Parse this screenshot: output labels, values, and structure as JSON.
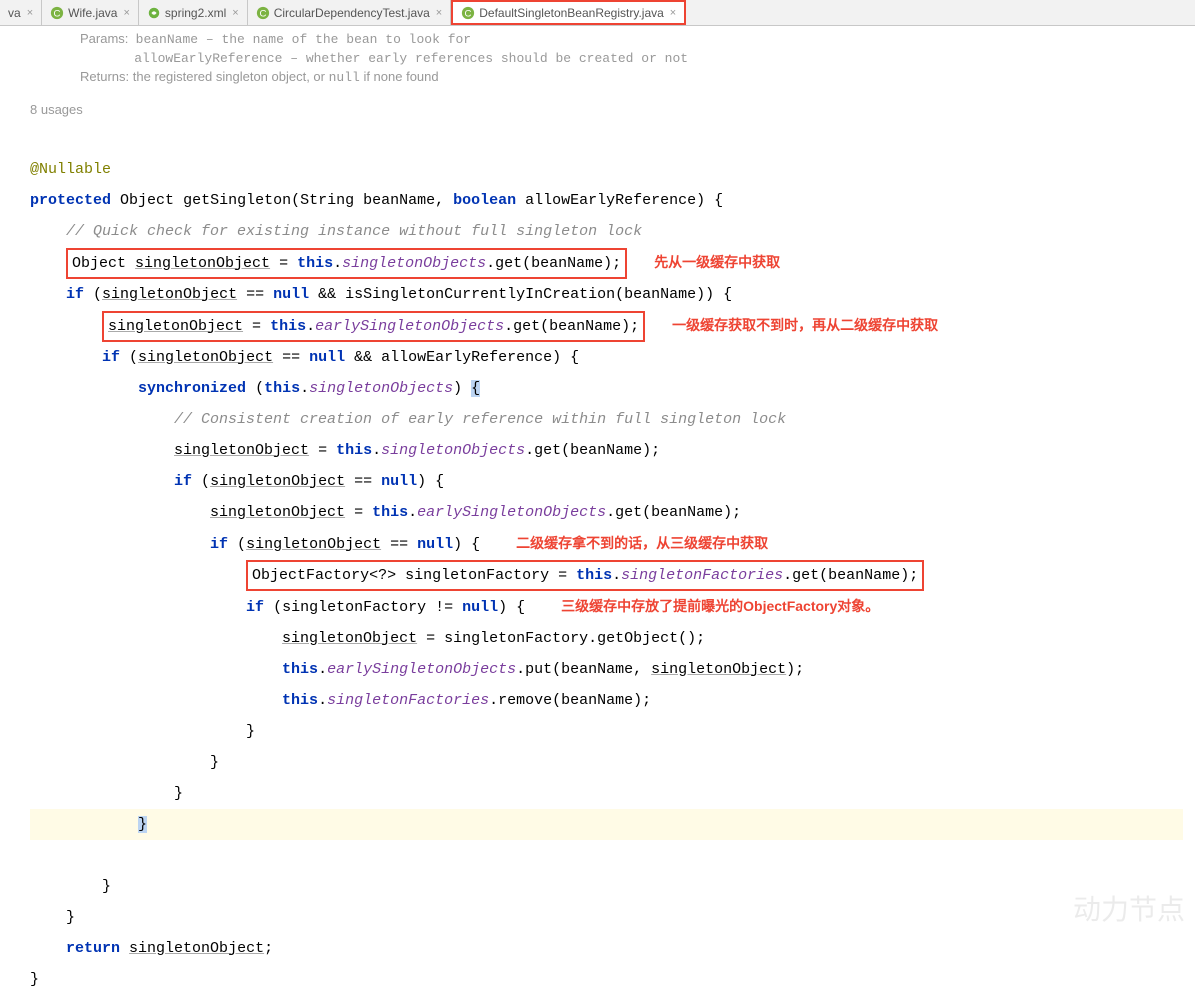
{
  "tabs": [
    {
      "label": "va",
      "icon": "partial"
    },
    {
      "label": "Wife.java",
      "icon": "class"
    },
    {
      "label": "spring2.xml",
      "icon": "spring"
    },
    {
      "label": "CircularDependencyTest.java",
      "icon": "class"
    },
    {
      "label": "DefaultSingletonBeanRegistry.java",
      "icon": "class",
      "active": true,
      "highlighted": true
    }
  ],
  "docinfo": {
    "params_line1_a": "Params:",
    "params_line1_b": "beanName – the name of the bean to look for",
    "params_line2": "allowEarlyReference – whether early references should be created or not",
    "returns_a": "Returns:",
    "returns_b": "the registered singleton object, or ",
    "returns_c": "null",
    "returns_d": " if none found"
  },
  "usages": "8 usages",
  "code": {
    "ann": "@Nullable",
    "sig_protected": "protected",
    "sig_Object": "Object",
    "sig_method": "getSingleton",
    "sig_params_open": "(String beanName, ",
    "sig_boolean": "boolean",
    "sig_params_rest": " allowEarlyReference) {",
    "c1": "// Quick check for existing instance without full singleton lock",
    "l1_a": "Object ",
    "l1_b": "singletonObject",
    "l1_eq": " = ",
    "l1_this": "this",
    "l1_dot": ".",
    "l1_f": "singletonObjects",
    "l1_get": ".get(beanName);",
    "ann1": "先从一级缓存中获取",
    "if1_if": "if",
    "if1_a": " (",
    "if1_so": "singletonObject",
    "if1_eqnull": " == ",
    "if1_null": "null",
    "if1_and": " && isSingletonCurrentlyInCreation(beanName)) {",
    "l2_so": "singletonObject",
    "l2_eq": " = ",
    "l2_this": "this",
    "l2_dot": ".",
    "l2_f": "earlySingletonObjects",
    "l2_get": ".get(beanName);",
    "ann2": "一级缓存获取不到时，再从二级缓存中获取",
    "if2_if": "if",
    "if2_a": " (",
    "if2_so": "singletonObject",
    "if2_eq": " == ",
    "if2_null": "null",
    "if2_rest": " && allowEarlyReference) {",
    "sync": "synchronized",
    "sync_a": " (",
    "sync_this": "this",
    "sync_dot": ".",
    "sync_f": "singletonObjects",
    "sync_b": ") ",
    "sync_brace": "{",
    "c2": "// Consistent creation of early reference within full singleton lock",
    "l3_so": "singletonObject",
    "l3_eq": " = ",
    "l3_this": "this",
    "l3_dot": ".",
    "l3_f": "singletonObjects",
    "l3_get": ".get(beanName);",
    "if3_if": "if",
    "if3_a": " (",
    "if3_so": "singletonObject",
    "if3_eq": " == ",
    "if3_null": "null",
    "if3_rest": ") {",
    "l4_so": "singletonObject",
    "l4_eq": " = ",
    "l4_this": "this",
    "l4_dot": ".",
    "l4_f": "earlySingletonObjects",
    "l4_get": ".get(beanName);",
    "if4_if": "if",
    "if4_a": " (",
    "if4_so": "singletonObject",
    "if4_eq": " == ",
    "if4_null": "null",
    "if4_rest": ") {",
    "ann3": "二级缓存拿不到的话，从三级缓存中获取",
    "l5_a": "ObjectFactory<?> singletonFactory = ",
    "l5_this": "this",
    "l5_dot": ".",
    "l5_f": "singletonFactories",
    "l5_get": ".get(beanName);",
    "if5_if": "if",
    "if5_a": " (singletonFactory != ",
    "if5_null": "null",
    "if5_rest": ") {",
    "ann4": "三级缓存中存放了提前曝光的ObjectFactory对象。",
    "l6_so": "singletonObject",
    "l6_eq": " = singletonFactory.getObject();",
    "l7_this": "this",
    "l7_dot": ".",
    "l7_f": "earlySingletonObjects",
    "l7_put": ".put(beanName, ",
    "l7_so": "singletonObject",
    "l7_end": ");",
    "l8_this": "this",
    "l8_dot": ".",
    "l8_f": "singletonFactories",
    "l8_rem": ".remove(beanName);",
    "cb": "}",
    "ret": "return",
    "ret_so": "singletonObject",
    "ret_end": ";"
  },
  "watermark": "动力节点"
}
